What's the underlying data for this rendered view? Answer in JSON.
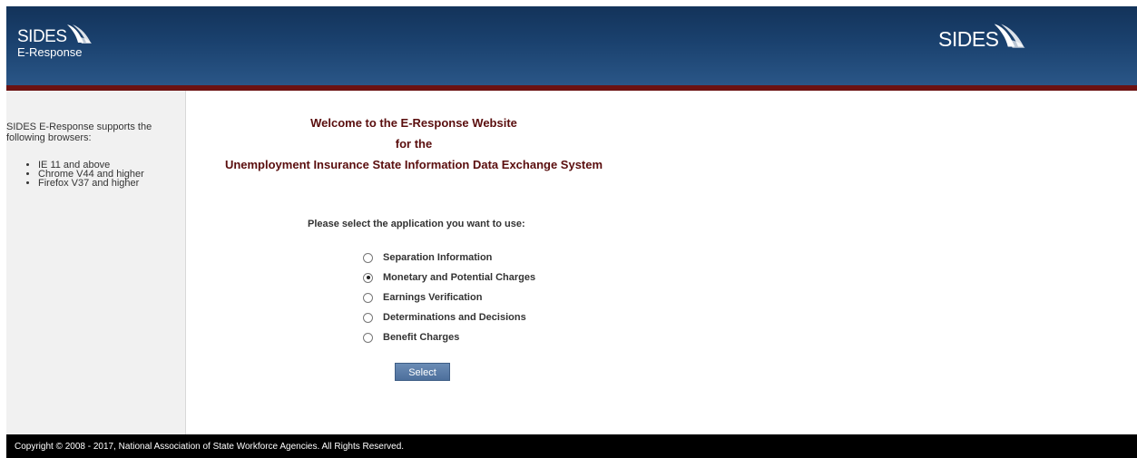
{
  "header": {
    "logo_left": {
      "brand": "SIDES",
      "sub": "E-Response"
    },
    "logo_right": {
      "brand": "SIDES"
    }
  },
  "sidebar": {
    "intro": "SIDES E-Response supports the following browsers:",
    "browsers": [
      "IE 11 and above",
      "Chrome V44 and higher",
      "Firefox V37 and higher"
    ]
  },
  "main": {
    "welcome_lines": [
      "Welcome to the E-Response Website",
      "for the",
      "Unemployment Insurance State Information Data Exchange System"
    ],
    "prompt": "Please select the application you want to use:",
    "options": [
      {
        "label": "Separation Information",
        "selected": false
      },
      {
        "label": "Monetary and Potential Charges",
        "selected": true
      },
      {
        "label": "Earnings Verification",
        "selected": false
      },
      {
        "label": "Determinations and Decisions",
        "selected": false
      },
      {
        "label": "Benefit Charges",
        "selected": false
      }
    ],
    "select_label": "Select"
  },
  "footer": {
    "copyright": "Copyright © 2008 - 2017, National Association of State Workforce Agencies. All Rights Reserved."
  },
  "colors": {
    "header_dark": "#13335a",
    "header_light": "#2a5687",
    "accent_rule": "#6b1212",
    "title_text": "#5a0e0e",
    "button": "#5a7ca8",
    "footer": "#000000"
  }
}
